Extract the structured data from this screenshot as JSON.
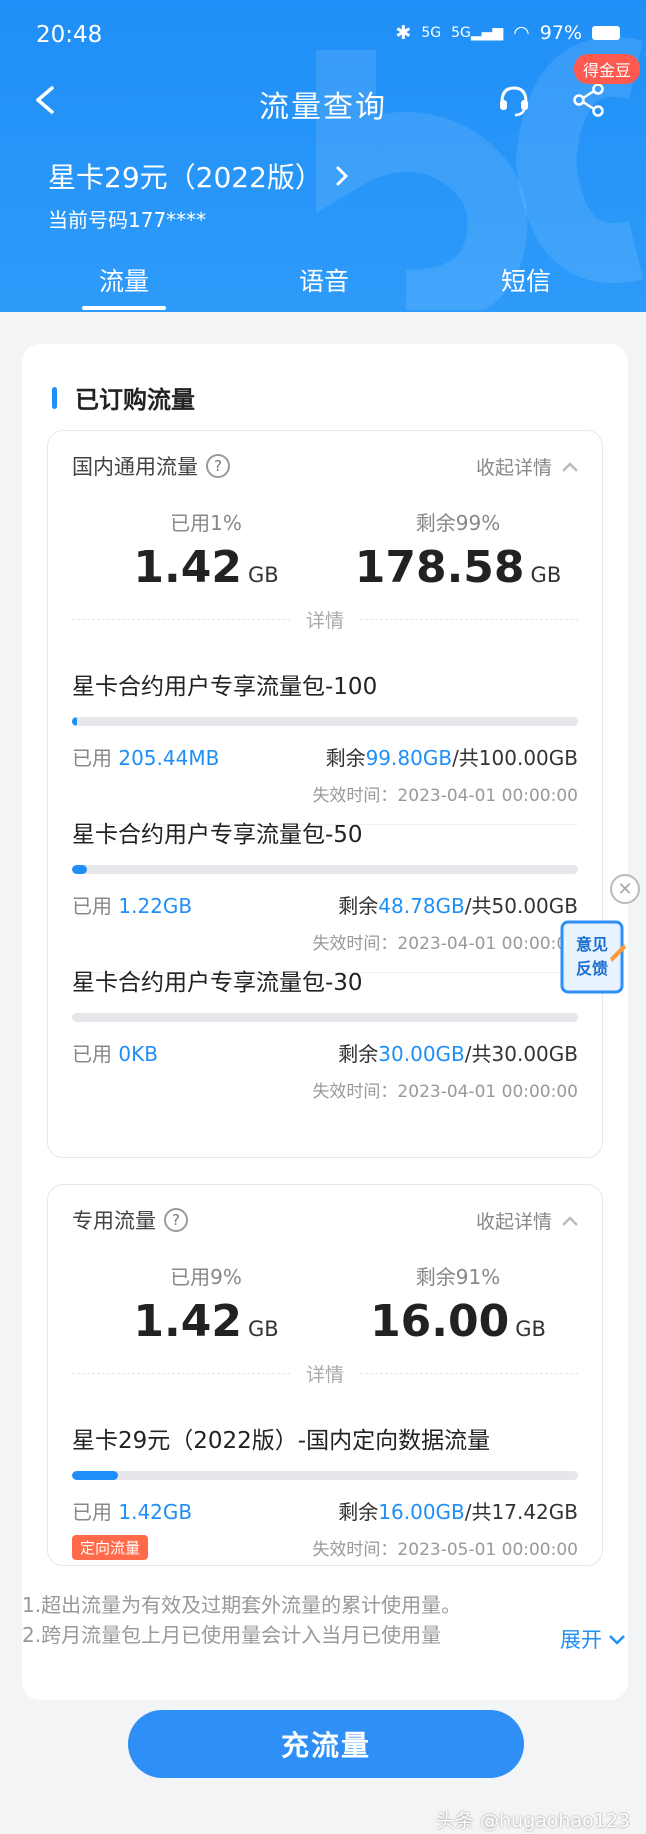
{
  "status_bar": {
    "time": "20:48",
    "battery": "97%",
    "network": "5G"
  },
  "nav": {
    "title": "流量查询",
    "badge": "得金豆"
  },
  "plan": {
    "name": "星卡29元（2022版）",
    "number": "当前号码177****"
  },
  "tabs": [
    {
      "label": "流量",
      "active": true
    },
    {
      "label": "语音"
    },
    {
      "label": "短信"
    }
  ],
  "section": {
    "title": "已订购流量"
  },
  "domestic": {
    "title": "国内通用流量",
    "collapse_label": "收起详情",
    "used_label": "已用1%",
    "used_value": "1.42",
    "used_unit": "GB",
    "remain_label": "剩余99%",
    "remain_value": "178.58",
    "remain_unit": "GB",
    "detail_label": "详情",
    "packages": [
      {
        "name": "星卡合约用户专享流量包-100",
        "used_prefix": "已用 ",
        "used": "205.44MB",
        "remain_prefix": "剩余",
        "remain": "99.80GB",
        "total": "/共100.00GB",
        "expire": "失效时间：2023-04-01 00:00:00",
        "progress": 0.01
      },
      {
        "name": "星卡合约用户专享流量包-50",
        "used_prefix": "已用 ",
        "used": "1.22GB",
        "remain_prefix": "剩余",
        "remain": "48.78GB",
        "total": "/共50.00GB",
        "expire": "失效时间：2023-04-01 00:00:00",
        "progress": 0.03
      },
      {
        "name": "星卡合约用户专享流量包-30",
        "used_prefix": "已用 ",
        "used": "0KB",
        "remain_prefix": "剩余",
        "remain": "30.00GB",
        "total": "/共30.00GB",
        "expire": "失效时间：2023-04-01 00:00:00",
        "progress": 0.0
      }
    ]
  },
  "special": {
    "title": "专用流量",
    "collapse_label": "收起详情",
    "used_label": "已用9%",
    "used_value": "1.42",
    "used_unit": "GB",
    "remain_label": "剩余91%",
    "remain_value": "16.00",
    "remain_unit": "GB",
    "detail_label": "详情",
    "package": {
      "name": "星卡29元（2022版）-国内定向数据流量",
      "used_prefix": "已用 ",
      "used": "1.42GB",
      "remain_prefix": "剩余",
      "remain": "16.00GB",
      "total": "/共17.42GB",
      "expire": "失效时间：2023-05-01 00:00:00",
      "tag": "定向流量",
      "progress": 0.09
    }
  },
  "notes": [
    "1.超出流量为有效及过期套外流量的累计使用量。",
    "2.跨月流量包上月已使用量会计入当月已使用量"
  ],
  "expand_label": "展开",
  "recharge_label": "充流量",
  "feedback_label": "意见反馈",
  "watermark": "头条 @hugaohao123",
  "colors": {
    "primary": "#1f8ff7",
    "tag": "#ff6b4a",
    "badge": "#ff5a4f"
  }
}
